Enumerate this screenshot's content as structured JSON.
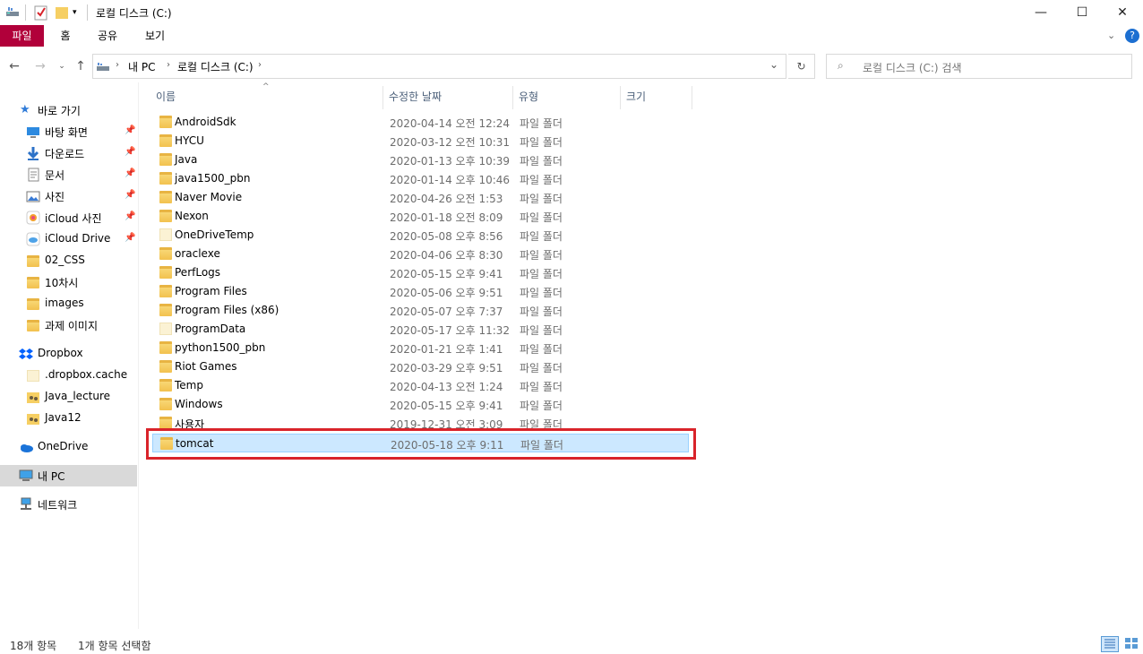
{
  "window": {
    "title": "로컬 디스크 (C:)",
    "controls": {
      "minimize": "—",
      "maximize": "☐",
      "close": "✕"
    }
  },
  "ribbon": {
    "tabs": [
      "파일",
      "홈",
      "공유",
      "보기"
    ],
    "active_tab_color": "#b1003a"
  },
  "address": {
    "breadcrumb": [
      "내 PC",
      "로컬 디스크 (C:)"
    ],
    "search_placeholder": "로컬 디스크 (C:) 검색"
  },
  "sidebar": {
    "quick_access_label": "바로 가기",
    "quick_items": [
      {
        "label": "바탕 화면",
        "icon": "desktop-icon",
        "pinned": true
      },
      {
        "label": "다운로드",
        "icon": "download-icon",
        "pinned": true
      },
      {
        "label": "문서",
        "icon": "document-icon",
        "pinned": true
      },
      {
        "label": "사진",
        "icon": "pictures-icon",
        "pinned": true
      },
      {
        "label": "iCloud 사진",
        "icon": "icloud-photos-icon",
        "pinned": true
      },
      {
        "label": "iCloud Drive",
        "icon": "icloud-drive-icon",
        "pinned": true
      },
      {
        "label": "02_CSS",
        "icon": "folder-icon",
        "pinned": false
      },
      {
        "label": "10차시",
        "icon": "folder-icon",
        "pinned": false
      },
      {
        "label": "images",
        "icon": "folder-icon",
        "pinned": false
      },
      {
        "label": "과제 이미지",
        "icon": "folder-icon",
        "pinned": false
      }
    ],
    "dropbox_label": "Dropbox",
    "dropbox_items": [
      ".dropbox.cache",
      "Java_lecture",
      "Java12"
    ],
    "onedrive_label": "OneDrive",
    "thispc_label": "내 PC",
    "network_label": "네트워크"
  },
  "columns": [
    "이름",
    "수정한 날짜",
    "유형",
    "크기"
  ],
  "files": [
    {
      "name": "AndroidSdk",
      "date": "2020-04-14 오전 12:24",
      "type": "파일 폴더",
      "pale": false
    },
    {
      "name": "HYCU",
      "date": "2020-03-12 오전 10:31",
      "type": "파일 폴더",
      "pale": false
    },
    {
      "name": "Java",
      "date": "2020-01-13 오후 10:39",
      "type": "파일 폴더",
      "pale": false
    },
    {
      "name": "java1500_pbn",
      "date": "2020-01-14 오후 10:46",
      "type": "파일 폴더",
      "pale": false
    },
    {
      "name": "Naver Movie",
      "date": "2020-04-26 오전 1:53",
      "type": "파일 폴더",
      "pale": false
    },
    {
      "name": "Nexon",
      "date": "2020-01-18 오전 8:09",
      "type": "파일 폴더",
      "pale": false
    },
    {
      "name": "OneDriveTemp",
      "date": "2020-05-08 오후 8:56",
      "type": "파일 폴더",
      "pale": true
    },
    {
      "name": "oraclexe",
      "date": "2020-04-06 오후 8:30",
      "type": "파일 폴더",
      "pale": false
    },
    {
      "name": "PerfLogs",
      "date": "2020-05-15 오후 9:41",
      "type": "파일 폴더",
      "pale": false
    },
    {
      "name": "Program Files",
      "date": "2020-05-06 오후 9:51",
      "type": "파일 폴더",
      "pale": false
    },
    {
      "name": "Program Files (x86)",
      "date": "2020-05-07 오후 7:37",
      "type": "파일 폴더",
      "pale": false
    },
    {
      "name": "ProgramData",
      "date": "2020-05-17 오후 11:32",
      "type": "파일 폴더",
      "pale": true
    },
    {
      "name": "python1500_pbn",
      "date": "2020-01-21 오후 1:41",
      "type": "파일 폴더",
      "pale": false
    },
    {
      "name": "Riot Games",
      "date": "2020-03-29 오후 9:51",
      "type": "파일 폴더",
      "pale": false
    },
    {
      "name": "Temp",
      "date": "2020-04-13 오전 1:24",
      "type": "파일 폴더",
      "pale": false
    },
    {
      "name": "Windows",
      "date": "2020-05-15 오후 9:41",
      "type": "파일 폴더",
      "pale": false
    },
    {
      "name": "사용자",
      "date": "2019-12-31 오전 3:09",
      "type": "파일 폴더",
      "pale": false
    },
    {
      "name": "tomcat",
      "date": "2020-05-18 오후 9:11",
      "type": "파일 폴더",
      "pale": false,
      "selected": true
    }
  ],
  "status": {
    "item_count": "18개 항목",
    "selection": "1개 항목 선택함"
  },
  "colors": {
    "selection_bg": "#cce8ff",
    "selection_border": "#99d1ff",
    "highlight_box": "#d9232a"
  }
}
